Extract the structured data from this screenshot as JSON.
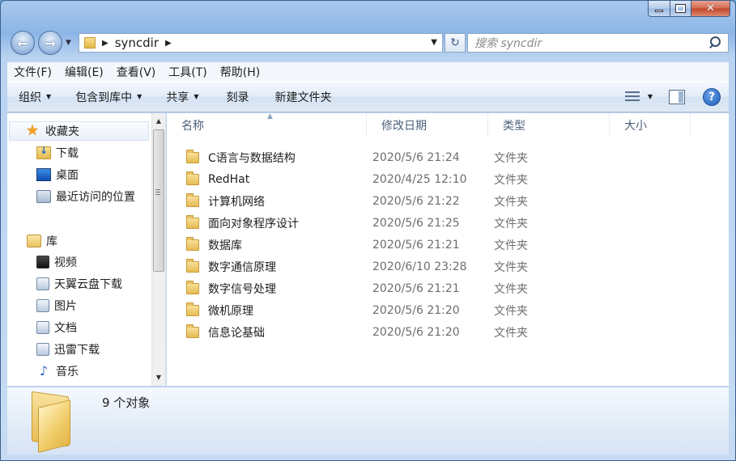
{
  "window": {
    "minimize_glyph": "",
    "close_glyph": "✕"
  },
  "address": {
    "path": "syncdir",
    "refresh_glyph": "↻"
  },
  "search": {
    "placeholder": "搜索 syncdir"
  },
  "menubar": [
    "文件(F)",
    "编辑(E)",
    "查看(V)",
    "工具(T)",
    "帮助(H)"
  ],
  "toolbar": {
    "organize": "组织",
    "include_in_library": "包含到库中",
    "share": "共享",
    "burn": "刻录",
    "new_folder": "新建文件夹",
    "help": "?"
  },
  "navpane": {
    "favorites": "收藏夹",
    "downloads": "下载",
    "desktop": "桌面",
    "recent": "最近访问的位置",
    "libraries": "库",
    "videos": "视频",
    "tianyi": "天翼云盘下载",
    "pictures": "图片",
    "documents": "文档",
    "xunlei": "迅雷下载",
    "music": "音乐"
  },
  "columns": [
    "名称",
    "修改日期",
    "类型",
    "大小"
  ],
  "files": [
    {
      "name": "C语言与数据结构",
      "date": "2020/5/6 21:24",
      "type": "文件夹"
    },
    {
      "name": "RedHat",
      "date": "2020/4/25 12:10",
      "type": "文件夹"
    },
    {
      "name": "计算机网络",
      "date": "2020/5/6 21:22",
      "type": "文件夹"
    },
    {
      "name": "面向对象程序设计",
      "date": "2020/5/6 21:25",
      "type": "文件夹"
    },
    {
      "name": "数据库",
      "date": "2020/5/6 21:21",
      "type": "文件夹"
    },
    {
      "name": "数字通信原理",
      "date": "2020/6/10 23:28",
      "type": "文件夹"
    },
    {
      "name": "数字信号处理",
      "date": "2020/5/6 21:21",
      "type": "文件夹"
    },
    {
      "name": "微机原理",
      "date": "2020/5/6 21:20",
      "type": "文件夹"
    },
    {
      "name": "信息论基础",
      "date": "2020/5/6 21:20",
      "type": "文件夹"
    }
  ],
  "details": {
    "count": "9 个对象"
  }
}
